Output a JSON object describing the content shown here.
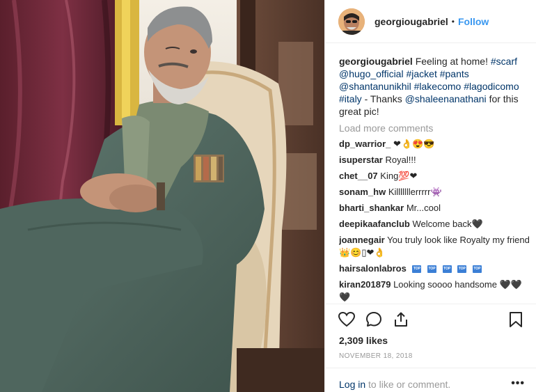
{
  "post": {
    "image_alt": "Man in green suit seated in an ornate chair by a window"
  },
  "header": {
    "username": "georgiougabriel",
    "separator": "•",
    "follow_label": "Follow"
  },
  "caption": {
    "username": "georgiougabriel",
    "text_1": "Feeling at home!",
    "tag_1": "#scarf",
    "tag_2": "@hugo_official",
    "tag_3": "#jacket",
    "tag_4": "#pants",
    "tag_5": "@shantanunikhil",
    "tag_6": "#lakecomo",
    "tag_7": "#lagodicomo",
    "tag_8": "#italy",
    "text_2": "- Thanks",
    "tag_9": "@shaleenanathani",
    "text_3": "for this great pic!"
  },
  "load_more_label": "Load more comments",
  "comments": [
    {
      "user": "dp_warrior_",
      "text": "❤👌😍😎"
    },
    {
      "user": "isuperstar",
      "text": "Royal!!!"
    },
    {
      "user": "chet__07",
      "text": "King💯❤"
    },
    {
      "user": "sonam_hw",
      "text": "Killlllllerrrrr👾"
    },
    {
      "user": "bharti_shankar",
      "text": "Mr...cool"
    },
    {
      "user": "deepikaafanclub",
      "text": "Welcome back🖤"
    },
    {
      "user": "joannegair",
      "text": "You truly look like Royalty my friend 👑😊▯❤👌"
    },
    {
      "user": "hairsalonlabros",
      "text": "",
      "badge": "TOP"
    },
    {
      "user": "kiran201879",
      "text": "Looking soooo handsome 🖤🖤🖤"
    }
  ],
  "likes": "2,309 likes",
  "date": "NOVEMBER 18, 2018",
  "footer": {
    "login_link": "Log in",
    "login_text": "to like or comment.",
    "more_label": "•••"
  },
  "icons": {
    "like": "heart-outline-icon",
    "comment": "speech-bubble-icon",
    "share": "share-arrow-icon",
    "save": "bookmark-icon",
    "more": "ellipsis-icon"
  },
  "colors": {
    "link": "#3897f0",
    "tag": "#003569",
    "muted": "#999999",
    "text": "#262626"
  }
}
